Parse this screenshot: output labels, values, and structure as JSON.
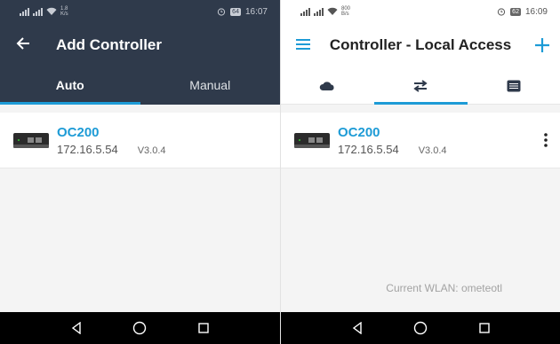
{
  "left": {
    "status": {
      "speed_value": "1.8",
      "speed_unit": "K/s",
      "battery": "64",
      "time": "16:07"
    },
    "appbar": {
      "title": "Add Controller"
    },
    "tabs": [
      {
        "label": "Auto"
      },
      {
        "label": "Manual"
      }
    ],
    "device": {
      "name": "OC200",
      "ip": "172.16.5.54",
      "version": "V3.0.4"
    }
  },
  "right": {
    "status": {
      "speed_value": "800",
      "speed_unit": "B/s",
      "battery": "62",
      "time": "16:09"
    },
    "appbar": {
      "title": "Controller - Local Access"
    },
    "tabs": [
      {
        "icon": "cloud-icon"
      },
      {
        "icon": "swap-arrows-icon"
      },
      {
        "icon": "list-icon"
      }
    ],
    "device": {
      "name": "OC200",
      "ip": "172.16.5.54",
      "version": "V3.0.4"
    },
    "footer_text": "Current WLAN: ometeotl"
  },
  "colors": {
    "header_dark": "#2f3a4b",
    "accent": "#1d9bd6"
  }
}
